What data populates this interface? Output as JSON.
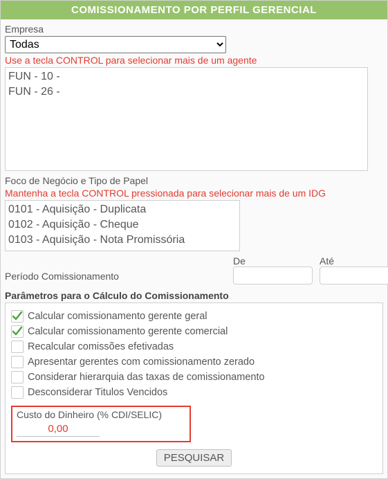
{
  "header": {
    "title": "COMISSIONAMENTO POR PERFIL GERENCIAL"
  },
  "empresa": {
    "label": "Empresa",
    "selected": "Todas",
    "options": [
      "Todas"
    ]
  },
  "agentes": {
    "hint": "Use a tecla CONTROL para selecionar mais de um agente",
    "items": [
      "FUN - 10 -",
      "FUN - 26 -"
    ]
  },
  "foco": {
    "label": "Foco de Negócio e Tipo de Papel",
    "hint": "Mantenha a tecla CONTROL pressionada para selecionar mais de um IDG",
    "items": [
      "0101 - Aquisição - Duplicata",
      "0102 - Aquisição - Cheque",
      "0103 - Aquisição - Nota Promissória"
    ]
  },
  "periodo": {
    "label": "Período Comissionamento",
    "de_label": "De",
    "ate_label": "Até",
    "de_value": "",
    "ate_value": ""
  },
  "params": {
    "title": "Parâmetros para o Cálculo do Comissionamento",
    "checks": [
      {
        "label": "Calcular comissionamento gerente geral",
        "checked": true
      },
      {
        "label": "Calcular comissionamento gerente comercial",
        "checked": true
      },
      {
        "label": "Recalcular comissões efetivadas",
        "checked": false
      },
      {
        "label": "Apresentar gerentes com comissionamento zerado",
        "checked": false
      },
      {
        "label": "Considerar hierarquia das taxas de comissionamento",
        "checked": false
      },
      {
        "label": "Desconsiderar Titulos Vencidos",
        "checked": false
      }
    ],
    "cdi": {
      "label": "Custo do Dinheiro (% CDI/SELIC)",
      "value": "0,00"
    }
  },
  "actions": {
    "pesquisar": "PESQUISAR"
  }
}
